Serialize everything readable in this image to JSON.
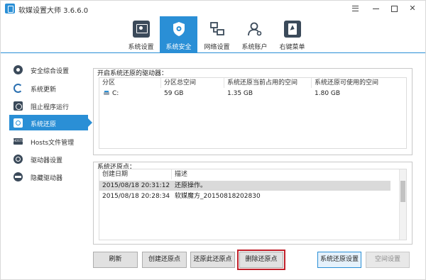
{
  "titlebar": {
    "title": "软媒设置大师 3.6.6.0"
  },
  "nav": {
    "tabs": [
      {
        "label": "系统设置",
        "icon": "system-settings-icon"
      },
      {
        "label": "系统安全",
        "icon": "shield-icon",
        "active": true
      },
      {
        "label": "网络设置",
        "icon": "network-icon"
      },
      {
        "label": "系统账户",
        "icon": "user-account-icon"
      },
      {
        "label": "右键菜单",
        "icon": "context-menu-icon"
      }
    ]
  },
  "sidebar": {
    "items": [
      {
        "label": "安全综合设置",
        "icon": "security-gear-icon"
      },
      {
        "label": "系统更新",
        "icon": "refresh-icon"
      },
      {
        "label": "阻止程序运行",
        "icon": "block-program-icon"
      },
      {
        "label": "系统还原",
        "icon": "system-restore-icon",
        "active": true
      },
      {
        "label": "Hosts文件管理",
        "icon": "hosts-file-icon"
      },
      {
        "label": "驱动器设置",
        "icon": "drive-settings-icon"
      },
      {
        "label": "隐藏驱动器",
        "icon": "hide-drive-icon"
      }
    ]
  },
  "drives_panel": {
    "label": "开启系统还原的驱动器：",
    "headers": [
      "分区",
      "分区总空间",
      "系统还原当前占用的空间",
      "系统还原可使用的空间"
    ],
    "rows": [
      {
        "partition": "C:",
        "total": "59 GB",
        "used": "1.35 GB",
        "available": "1.80 GB"
      }
    ]
  },
  "restore_points_panel": {
    "label": "系统还原点：",
    "headers": [
      "创建日期",
      "描述"
    ],
    "rows": [
      {
        "date": "2015/08/18 20:31:12",
        "description": "还原操作。",
        "selected": true
      },
      {
        "date": "2015/08/18 20:28:34",
        "description": "软媒魔方_20150818202830",
        "selected": false
      }
    ]
  },
  "buttons": {
    "refresh": "刷新",
    "create": "创建还原点",
    "restore": "还原此还原点",
    "delete": "删除还原点",
    "settings": "系统还原设置",
    "space": "空间设置"
  },
  "colors": {
    "accent": "#2a8fd6",
    "highlight_border": "#c0202a"
  }
}
